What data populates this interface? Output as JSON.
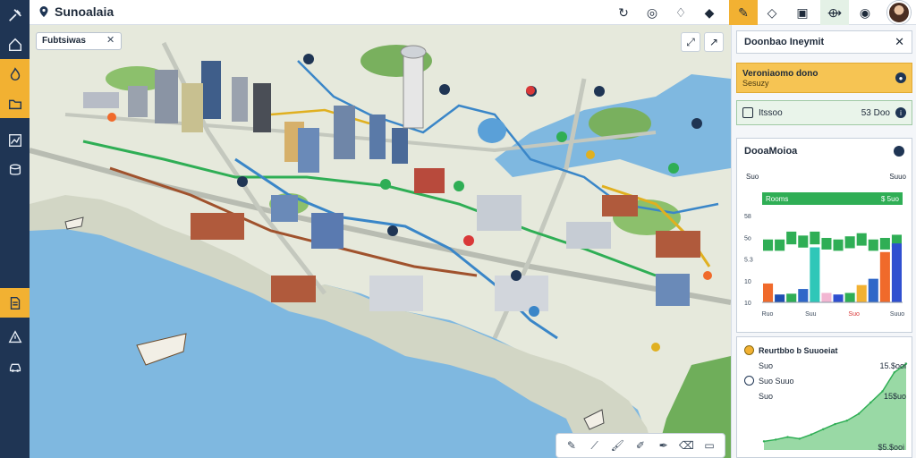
{
  "app": {
    "title": "Sunoalaia"
  },
  "toolbar": {
    "icons": [
      "refresh-icon",
      "layers-icon",
      "bell-icon",
      "tag-icon",
      "bookmark-icon",
      "diamond-icon",
      "book-icon",
      "route-icon",
      "compass-icon"
    ]
  },
  "map": {
    "search_value": "Fubtsiwas",
    "accent_water": "#7fb8e0",
    "accent_route_green": "#2fae55",
    "accent_route_blue": "#3a86c8",
    "accent_route_brown": "#a0522d",
    "accent_route_yellow": "#e0b020"
  },
  "panel": {
    "header": "Doonbao Ineymit",
    "row1": {
      "title": "Veroniaomo dono",
      "subtitle": "Sesuzy"
    },
    "row2": {
      "label": "Itssoo",
      "value": "53  Doo"
    },
    "chart1": {
      "title": "DooaMoioa",
      "top_left": "Suo",
      "top_right": "Suuo",
      "band_left": "Rooms",
      "band_right": "$ 5uo",
      "y_ticks": [
        "58",
        "5o",
        "5.3",
        "10",
        "10"
      ],
      "x_ticks": [
        "Ruo",
        "Suu",
        "Suo",
        "Suuo"
      ]
    },
    "chart2": {
      "rank1": "Reurtbbo b Suuoeiat",
      "rank2": "Suo",
      "rank3": "Suo Suuo",
      "rank4": "Suo",
      "v1": "15.$ooi",
      "v2": "15$uo",
      "v3": "$5.$ooi"
    }
  },
  "chart_data": [
    {
      "type": "bar",
      "title": "DooaMoioa",
      "categories": [
        "Ruo",
        "",
        "",
        "Suu",
        "",
        "",
        "",
        "Suo",
        "",
        "",
        "",
        "Suuo"
      ],
      "values": [
        24,
        10,
        11,
        17,
        70,
        12,
        10,
        12,
        22,
        30,
        64,
        75
      ],
      "colors": [
        "#f06a2b",
        "#1f4fb2",
        "#2fae55",
        "#2f67c8",
        "#2fc7b8",
        "#f2b6d2",
        "#2f4fd0",
        "#2fae55",
        "#f2b132",
        "#2f67c8",
        "#f06a2b",
        "#2f4fd0"
      ],
      "background_values": [
        80,
        80,
        90,
        85,
        90,
        82,
        80,
        84,
        88,
        80,
        82,
        86
      ],
      "ylim": [
        0,
        140
      ]
    },
    {
      "type": "area",
      "x": [
        0,
        1,
        2,
        3,
        4,
        5,
        6,
        7,
        8,
        9,
        10,
        11,
        12
      ],
      "y": [
        10,
        12,
        15,
        13,
        18,
        24,
        30,
        34,
        42,
        55,
        68,
        90,
        100
      ],
      "ylim": [
        0,
        110
      ]
    }
  ]
}
